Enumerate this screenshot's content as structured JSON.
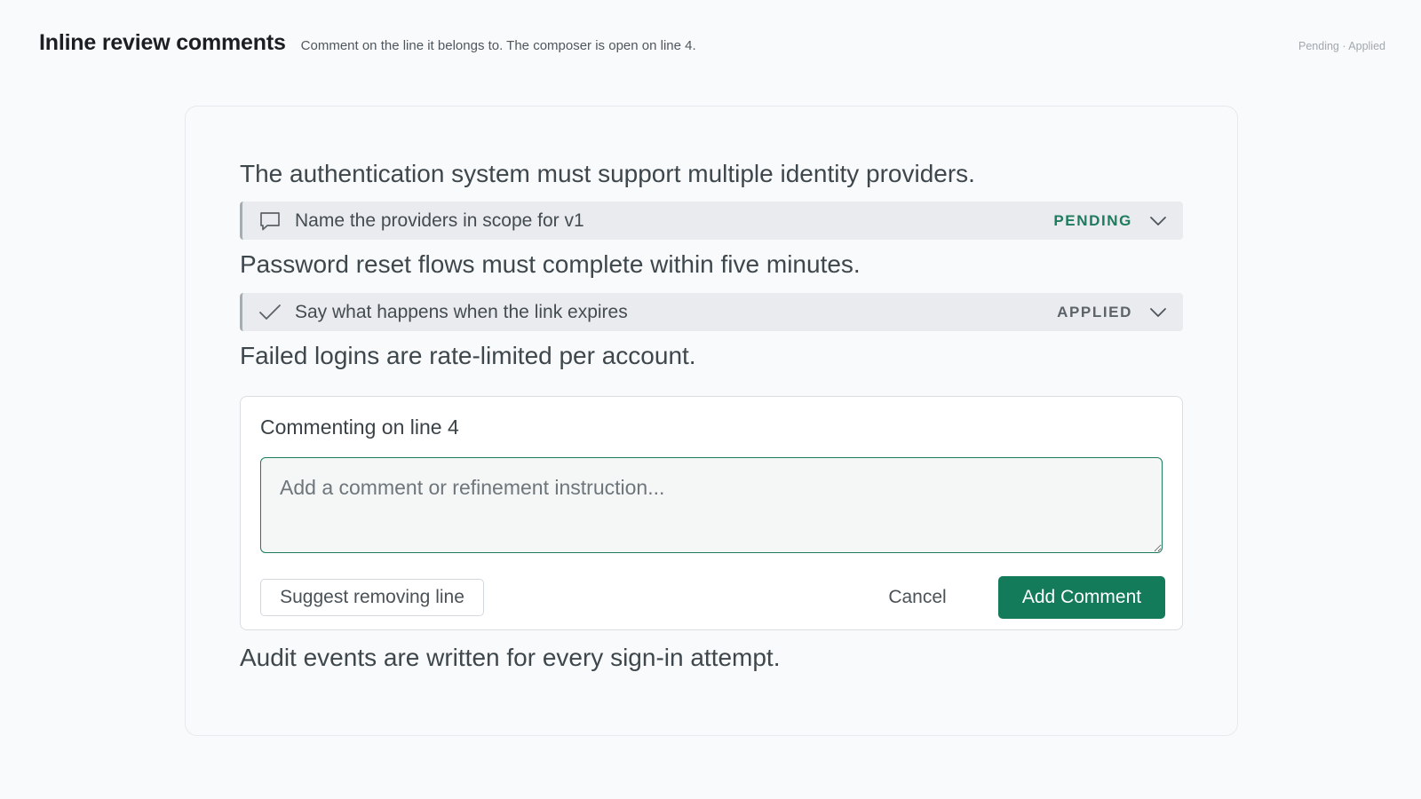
{
  "header": {
    "title": "Inline review comments",
    "subtitle": "Comment on the line it belongs to. The composer is open on line 4.",
    "legend": "Pending · Applied"
  },
  "document": {
    "lines": [
      "The authentication system must support multiple identity providers.",
      "Password reset flows must complete within five minutes.",
      "Failed logins are rate-limited per account.",
      "Audit events are written for every sign-in attempt."
    ],
    "comments": [
      {
        "text": "Name the providers in scope for v1",
        "status": "PENDING",
        "icon": "speech-bubble-icon",
        "status_color": "#1e7b5b"
      },
      {
        "text": "Say what happens when the link expires",
        "status": "APPLIED",
        "icon": "checkmark-icon",
        "status_color": "#5c646a"
      }
    ]
  },
  "composer": {
    "title": "Commenting on line 4",
    "placeholder": "Add a comment or refinement instruction...",
    "value": "",
    "suggest_label": "Suggest removing line",
    "cancel_label": "Cancel",
    "add_label": "Add Comment"
  },
  "colors": {
    "accent": "#137a5a",
    "page_background": "#f9fafc",
    "comment_bar": "#e9ebee"
  }
}
